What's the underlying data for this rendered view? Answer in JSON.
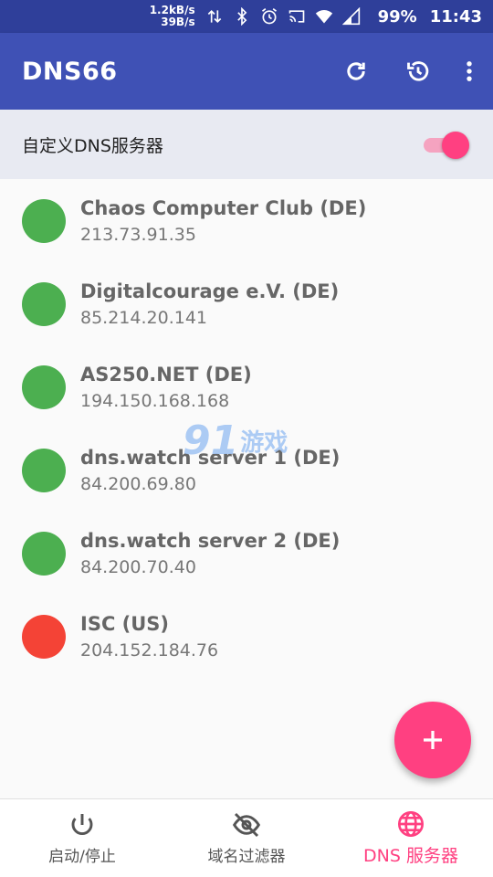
{
  "status_bar": {
    "speed_up": "1.2kB/s",
    "speed_down": "39B/s",
    "icons": [
      "data-arrows-icon",
      "bluetooth-icon",
      "alarm-icon",
      "cast-icon",
      "wifi-icon",
      "signal-icon"
    ],
    "battery": "99%",
    "time": "11:43"
  },
  "app_bar": {
    "title": "DNS66",
    "actions": [
      "refresh-icon",
      "history-icon",
      "more-vert-icon"
    ]
  },
  "custom_dns": {
    "label": "自定义DNS服务器",
    "enabled": true
  },
  "servers": [
    {
      "name": "Chaos Computer Club (DE)",
      "address": "213.73.91.35",
      "status_color": "#4caf50"
    },
    {
      "name": "Digitalcourage e.V. (DE)",
      "address": "85.214.20.141",
      "status_color": "#4caf50"
    },
    {
      "name": "AS250.NET (DE)",
      "address": "194.150.168.168",
      "status_color": "#4caf50"
    },
    {
      "name": "dns.watch server 1 (DE)",
      "address": "84.200.69.80",
      "status_color": "#4caf50"
    },
    {
      "name": "dns.watch server 2 (DE)",
      "address": "84.200.70.40",
      "status_color": "#4caf50"
    },
    {
      "name": "ISC (US)",
      "address": "204.152.184.76",
      "status_color": "#f44336"
    }
  ],
  "watermark": {
    "number": "91",
    "text": "游戏"
  },
  "fab": {
    "icon": "add-icon"
  },
  "bottom_nav": {
    "items": [
      {
        "label": "启动/停止",
        "icon": "power-icon",
        "active": false
      },
      {
        "label": "域名过滤器",
        "icon": "eye-off-icon",
        "active": false
      },
      {
        "label": "DNS 服务器",
        "icon": "globe-icon",
        "active": true
      }
    ]
  },
  "colors": {
    "primary": "#3f51b5",
    "primary_dark": "#2f3f9a",
    "accent": "#ff4081"
  }
}
